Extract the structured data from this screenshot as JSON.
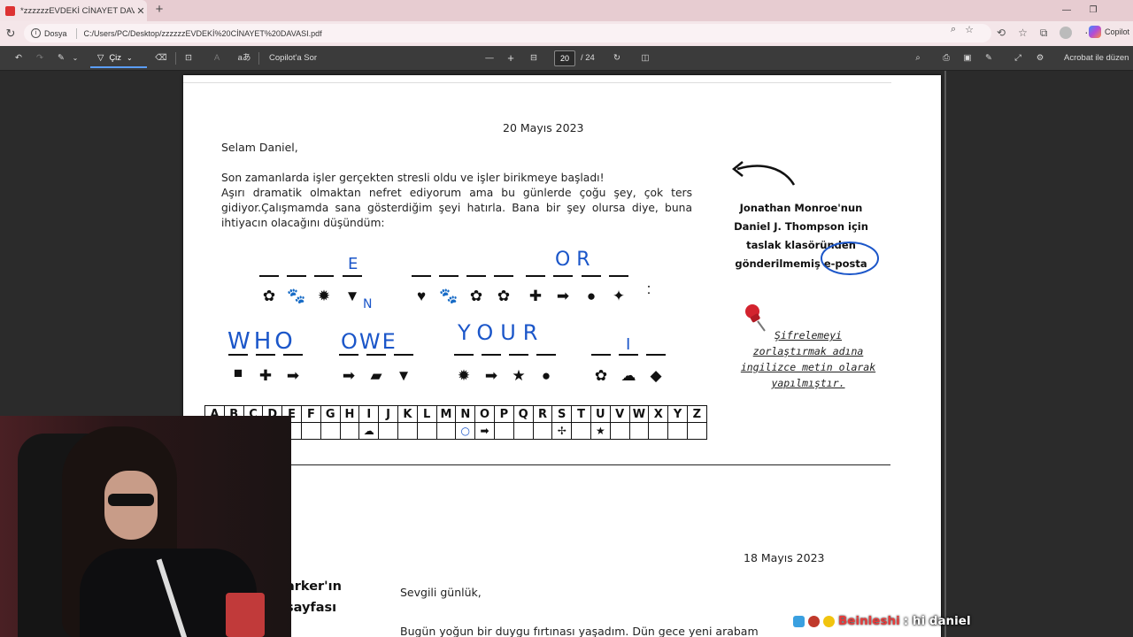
{
  "browser": {
    "tab_title": "*zzzzzzEVDEKİ CİNAYET DAVASI.p",
    "tab_close": "✕",
    "new_tab": "+",
    "address_label": "Dosya",
    "url": "C:/Users/PC/Desktop/zzzzzzEVDEKİ%20CİNAYET%20DAVASI.pdf",
    "copilot_label": "Copilot"
  },
  "pdf_toolbar": {
    "draw_label": "Çiz",
    "copilot_ask": "Copilot'a Sor",
    "current_page": "20",
    "total_pages": "/ 24",
    "acrobat_label": "Acrobat ile düzen"
  },
  "document": {
    "date1": "20 Mayıs 2023",
    "greeting": "Selam Daniel,",
    "paragraph1": "Son zamanlarda işler gerçekten stresli oldu ve işler birikmeye başladı!",
    "paragraph2": "Aşırı dramatik olmaktan nefret ediyorum ama bu günlerde çoğu şey, çok ters gidiyor.Çalışmamda sana gösterdiğim şeyi hatırla. Bana bir şey olursa diye, buna ihtiyacın olacağını düşündüm:",
    "side_note": [
      "Jonathan Monroe'nun",
      "Daniel J. Thompson için",
      "taslak klasöründen",
      "gönderilmemiş e-posta"
    ],
    "hint": [
      "Şifrelemeyi",
      "zorlaştırmak adına",
      "ingilizce metin olarak",
      "yapılmıştır."
    ],
    "colon": ":",
    "alphabet": [
      "A",
      "B",
      "C",
      "D",
      "E",
      "F",
      "G",
      "H",
      "I",
      "J",
      "K",
      "L",
      "M",
      "N",
      "O",
      "P",
      "Q",
      "R",
      "S",
      "T",
      "U",
      "V",
      "W",
      "X",
      "Y",
      "Z"
    ],
    "alphabet_keys": [
      "",
      "▼",
      "",
      "",
      "",
      "",
      "",
      "",
      "☁",
      "",
      "",
      "",
      "",
      "○",
      "➡",
      "",
      "",
      "",
      "✢",
      "",
      "★",
      "",
      "",
      "",
      "",
      ""
    ],
    "row1_symbols": [
      "✿",
      "🐾",
      "✹",
      "▼",
      "♥",
      "🐾",
      "✿",
      "✿",
      "✚",
      "➡",
      "●",
      "✦"
    ],
    "row2_symbols": [
      "■",
      "✚",
      "➡",
      "➡",
      "▰",
      "▼",
      "✹",
      "➡",
      "★",
      "●",
      "✿",
      "☁",
      "◆"
    ],
    "handwriting": {
      "row1_e": "E",
      "row1_or": "O R",
      "n_mark": "N",
      "who": "WHO",
      "owe": "OWE",
      "your": "YOUR",
      "i": "I"
    },
    "date2": "18 Mayıs 2023",
    "side_title": [
      "arker'ın",
      "sayfası"
    ],
    "greeting2": "Sevgili günlük,",
    "paragraph3": "Bugün yoğun bir duygu fırtınası yaşadım. Dün gece yeni arabam"
  },
  "chat": {
    "username": "Beinleshi",
    "message": ": hi daniel"
  },
  "colors": {
    "tab_bar": "#e7ccd1",
    "pdf_toolbar": "#3b3b3b",
    "accent": "#5b9df9",
    "handwriting": "#1b56c9"
  }
}
